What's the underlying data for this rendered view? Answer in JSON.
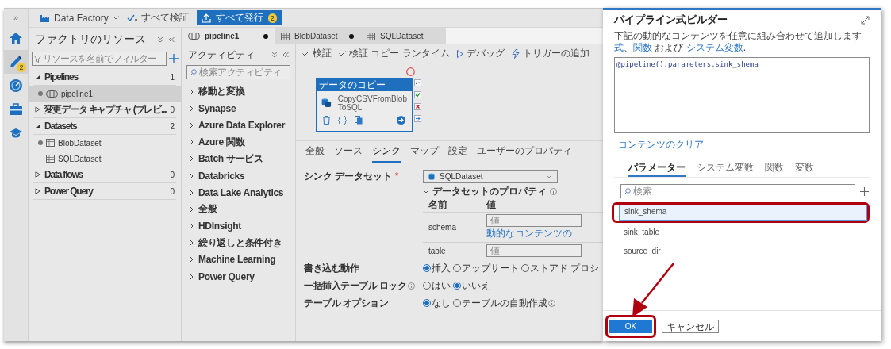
{
  "rail": {
    "expand": "»",
    "items": [
      {
        "kind": "home",
        "selected": false
      },
      {
        "kind": "author",
        "selected": true,
        "badge": "2"
      },
      {
        "kind": "monitor",
        "selected": false
      },
      {
        "kind": "manage",
        "selected": false
      },
      {
        "kind": "learn",
        "selected": false
      }
    ]
  },
  "topbar": {
    "factory": "Data Factory",
    "validate": "すべて検証",
    "publish": {
      "label": "すべて発行",
      "count": "2"
    }
  },
  "resources": {
    "title": "ファクトリのリソース",
    "filter_placeholder": "リソースを名前でフィルター",
    "sections": [
      {
        "label": "Pipelines",
        "count": "1",
        "expanded": true,
        "children": [
          {
            "label": "pipeline1",
            "kind": "pipeline",
            "selected": true,
            "unsaved": true
          }
        ]
      },
      {
        "label": "変更データ キャプチャ (プレビ...",
        "count": "0",
        "expanded": false
      },
      {
        "label": "Datasets",
        "count": "2",
        "expanded": true,
        "children": [
          {
            "label": "BlobDataset",
            "kind": "dataset",
            "selected": false,
            "unsaved": true
          },
          {
            "label": "SQLDataset",
            "kind": "dataset",
            "selected": false,
            "unsaved": false
          }
        ]
      },
      {
        "label": "Data flows",
        "count": "0",
        "expanded": false
      },
      {
        "label": "Power Query",
        "count": "0",
        "expanded": false
      }
    ]
  },
  "tabs": [
    {
      "label": "pipeline1",
      "kind": "pipeline",
      "selected": true,
      "unsaved": true
    },
    {
      "label": "BlobDataset",
      "kind": "dataset",
      "selected": false,
      "unsaved": true
    },
    {
      "label": "SQLDataset",
      "kind": "dataset",
      "selected": false,
      "unsaved": false
    }
  ],
  "activities": {
    "title": "アクティビティ",
    "search_placeholder": "検索アクティビティ",
    "items": [
      "移動と変換",
      "Synapse",
      "Azure Data Explorer",
      "Azure 関数",
      "Batch サービス",
      "Databricks",
      "Data Lake Analytics",
      "全般",
      "HDInsight",
      "繰り返しと条件付き",
      "Machine Learning",
      "Power Query"
    ]
  },
  "toolbar": [
    {
      "kind": "check",
      "label": "検証"
    },
    {
      "kind": "check",
      "label": "検証 コピー ランタイム"
    },
    {
      "kind": "play",
      "label": "デバッグ"
    },
    {
      "kind": "trigger",
      "label": "トリガーの追加"
    }
  ],
  "activity_node": {
    "header": "データのコピー",
    "name_lines": [
      "CopyCSVFromBlob",
      "ToSQL"
    ]
  },
  "property_tabs": [
    {
      "label": "全般",
      "selected": false
    },
    {
      "label": "ソース",
      "selected": false
    },
    {
      "label": "シンク",
      "selected": true
    },
    {
      "label": "マップ",
      "selected": false
    },
    {
      "label": "設定",
      "selected": false
    },
    {
      "label": "ユーザーのプロパティ",
      "selected": false
    }
  ],
  "sink": {
    "dataset_label": "シンク データセット",
    "required": "*",
    "dataset_value": "SQLDataset",
    "properties_title": "データセットのプロパティ",
    "columns": [
      "名前",
      "値"
    ],
    "rows": [
      {
        "name": "schema",
        "placeholder": "値",
        "link": "動的なコンテンツの"
      },
      {
        "name": "table",
        "placeholder": "値"
      }
    ],
    "options": [
      {
        "label": "書き込む動作",
        "info": false,
        "choices": [
          {
            "label": "挿入",
            "selected": true,
            "info": false
          },
          {
            "label": "アップサート",
            "selected": false,
            "info": false
          },
          {
            "label": "ストアド プロシ",
            "selected": false,
            "info": false
          }
        ]
      },
      {
        "label": "一括挿入テーブル ロック",
        "info": true,
        "choices": [
          {
            "label": "はい",
            "selected": false,
            "info": false
          },
          {
            "label": "いいえ",
            "selected": true,
            "info": false
          }
        ]
      },
      {
        "label": "テーブル オプション",
        "info": false,
        "choices": [
          {
            "label": "なし",
            "selected": true,
            "info": false
          },
          {
            "label": "テーブルの自動作成",
            "selected": false,
            "info": true
          }
        ]
      }
    ]
  },
  "dialog": {
    "title": "パイプライン式ビルダー",
    "description": [
      {
        "kind": "text",
        "text": "下記の動的なコンテンツを任意に組み合わせて追加します "
      },
      {
        "kind": "link",
        "text": "式"
      },
      {
        "kind": "text",
        "text": "、"
      },
      {
        "kind": "link",
        "text": "関数"
      },
      {
        "kind": "text",
        "text": " および "
      },
      {
        "kind": "link",
        "text": "システム変数"
      },
      {
        "kind": "text",
        "text": "."
      }
    ],
    "expression": "@pipeline().parameters.sink_shema",
    "clear": "コンテンツのクリア",
    "tabs": [
      {
        "label": "パラメーター",
        "selected": true
      },
      {
        "label": "システム変数",
        "selected": false
      },
      {
        "label": "関数",
        "selected": false
      },
      {
        "label": "変数",
        "selected": false
      }
    ],
    "search_placeholder": "検索",
    "parameters": [
      {
        "label": "sink_shema",
        "selected": true,
        "highlighted": true
      },
      {
        "label": "sink_table",
        "selected": false,
        "highlighted": false
      },
      {
        "label": "source_dir",
        "selected": false,
        "highlighted": false
      }
    ],
    "buttons": [
      {
        "label": "OK",
        "kind": "primary",
        "highlighted": true
      },
      {
        "label": "キャンセル",
        "kind": "secondary",
        "highlighted": false
      }
    ]
  }
}
